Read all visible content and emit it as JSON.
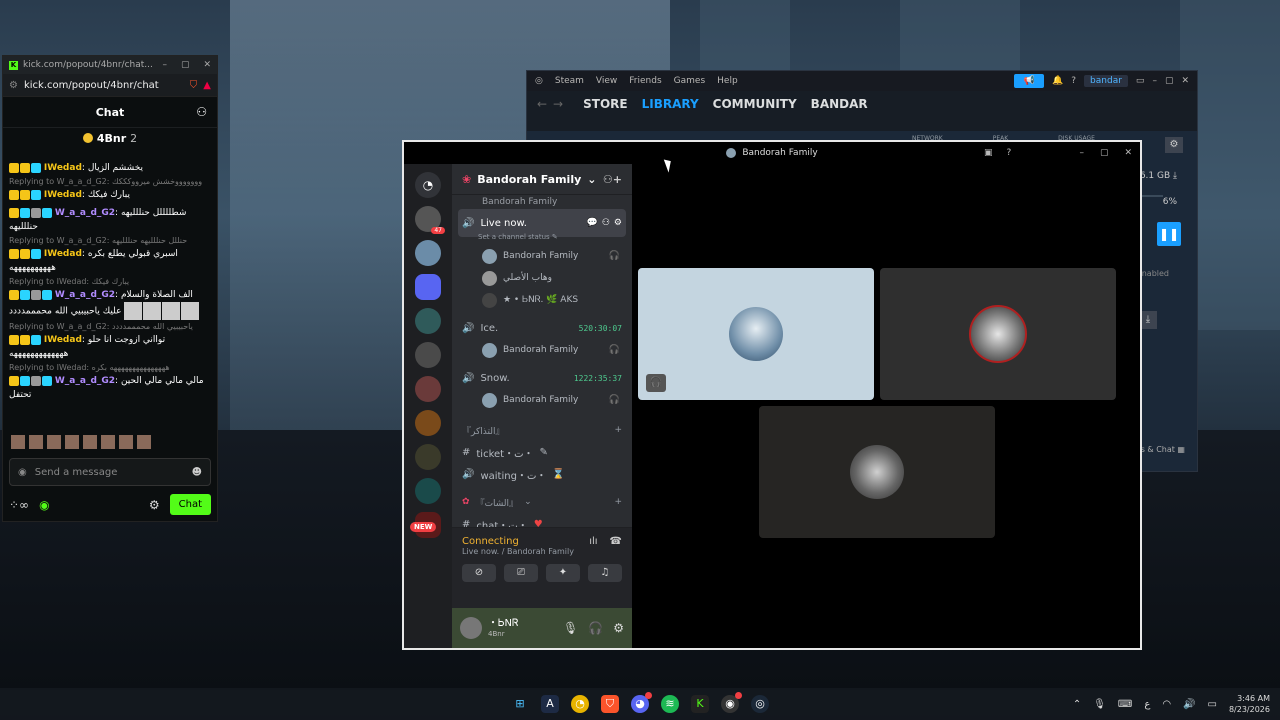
{
  "kick": {
    "tab_title": "kick.com/popout/4bnr/chat...",
    "url": "kick.com/popout/4bnr/chat",
    "header": "Chat",
    "pinned_user": "4Bnr",
    "pinned_count": "2",
    "messages": [
      {
        "reply": "",
        "user": "IWedad",
        "text": "يخششم الزيال",
        "user_class": "u-wedad"
      },
      {
        "reply": "Replying to W_a_a_d_G2: وووووووخشش ميرووكككك",
        "user": "IWedad",
        "text": "يبارك فيكك",
        "user_class": "u-wedad"
      },
      {
        "reply": "",
        "user": "W_a_a_d_G2",
        "text": "شطللللل حنللليهه حنللليهه",
        "user_class": "u-waad"
      },
      {
        "reply": "Replying to W_a_a_d_G2: حنللل حنللليهه حنللليهه",
        "user": "IWedad",
        "text": "اسبري قبولي يطلع بكره ههههههههههه",
        "user_class": "u-wedad"
      },
      {
        "reply": "Replying to IWedad: يبارك فيكك",
        "user": "W_a_a_d_G2",
        "text": "الف الصلاة والسلام عليك ياحبيبيي الله محمممدددد",
        "user_class": "u-waad"
      },
      {
        "reply": "Replying to W_a_a_d_G2: ياحبيبيي الله محمممدددد",
        "user": "IWedad",
        "text": "توااني ازوجت انا حلو هههههههههههههه",
        "user_class": "u-wedad"
      },
      {
        "reply": "Replying to IWedad: هههههههههههههههه بكره",
        "user": "W_a_a_d_G2",
        "text": "مالي مالي مالي الحين تحتفل",
        "user_class": "u-waad"
      }
    ],
    "input_placeholder": "Send a message",
    "chat_button": "Chat"
  },
  "steam": {
    "menu": [
      "Steam",
      "View",
      "Friends",
      "Games",
      "Help"
    ],
    "user": "bandar",
    "nav": [
      "STORE",
      "LIBRARY",
      "COMMUNITY",
      "BANDAR"
    ],
    "active_nav": "LIBRARY",
    "stats": [
      "NETWORK",
      "PEAK",
      "DISK USAGE"
    ],
    "size": "8 / 56.1 GB",
    "percent": "6%",
    "enabled_text": "enabled",
    "friends_chat": "Friends & Chat"
  },
  "discord": {
    "window_title": "Bandorah Family",
    "server_name": "Bandorah Family",
    "top_user": "Bandorah Family",
    "live_channel": "Live now.",
    "live_status": "Set a channel status",
    "live_users": [
      "Bandorah Family",
      "وهاب الأصلي",
      "★ • ᏏNᏒ. 🌿 AKS"
    ],
    "ice_channel": "Ice.",
    "ice_timer": "520:30:07",
    "ice_user": "Bandorah Family",
    "snow_channel": "Snow.",
    "snow_timer": "1222:35:37",
    "snow_user": "Bandorah Family",
    "cat1": "『التذاكر』",
    "ticket": "ticket・ت・",
    "waiting": "waiting・ت・",
    "cat2": "『الشات』",
    "chat": "chat・ت・",
    "guild_badges": [
      "47",
      "NEW"
    ],
    "vc_status": "Connecting",
    "vc_sub": "Live now. / Bandorah Family",
    "user_name": "・ᏏNᏒ",
    "user_sub": "4Bnr"
  },
  "taskbar": {
    "time": "3:46 AM",
    "date": "8/23/2026",
    "lang": "ع"
  }
}
